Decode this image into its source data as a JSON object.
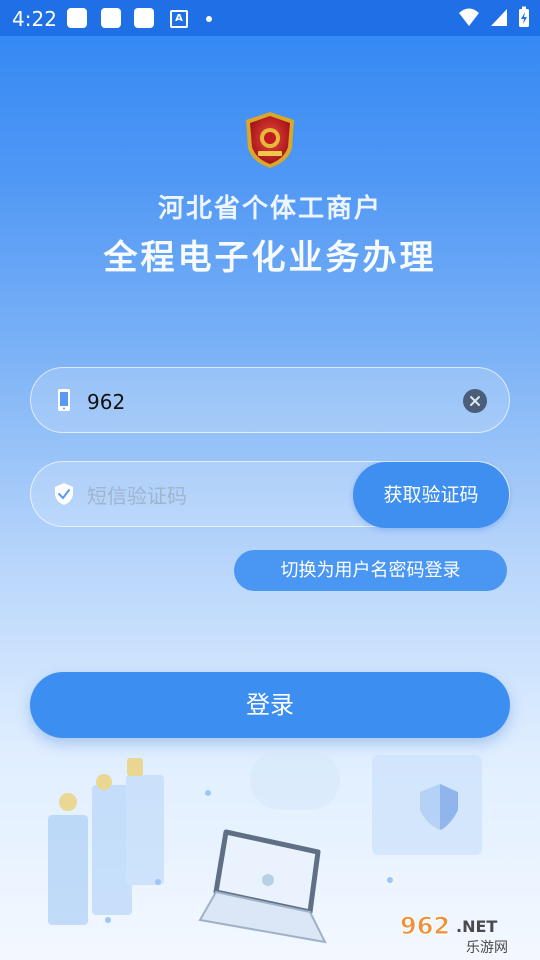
{
  "status_bar": {
    "time": "4:22",
    "a_label": "A"
  },
  "header": {
    "title_line1": "河北省个体工商户",
    "title_line2": "全程电子化业务办理"
  },
  "login_form": {
    "phone_value": "962",
    "code_placeholder": "短信验证码",
    "get_code_label": "获取验证码",
    "switch_label": "切换为用户名密码登录",
    "login_label": "登录"
  },
  "watermark": {
    "text_top": "962.NET",
    "text_bottom": "乐游网"
  },
  "colors": {
    "accent": "#3d8ef1",
    "status_bar": "#1f6fe6"
  }
}
